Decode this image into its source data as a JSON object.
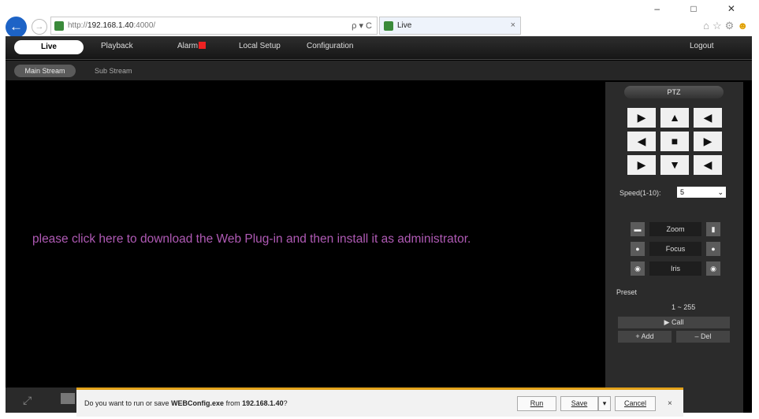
{
  "browser": {
    "url_prefix": "http://",
    "url_host": "192.168.1.40",
    "url_suffix": ":4000/",
    "address_tools": "ρ ▾ C",
    "tab_title": "Live",
    "tab_close": "×",
    "back_icon": "←",
    "forward_icon": "→",
    "window_buttons": "– □ ✕",
    "toolbar_icons": "⌂☆⚙"
  },
  "nav": {
    "items": [
      "Live",
      "Playback",
      "Alarm",
      "Local Setup",
      "Configuration"
    ],
    "logout": "Logout"
  },
  "subnav": {
    "main_stream": "Main Stream",
    "sub_stream": "Sub Stream"
  },
  "video": {
    "plugin_message": "please click here to download the Web Plug-in and then install it as administrator."
  },
  "ptz": {
    "title": "PTZ",
    "directions": [
      "▶",
      "▲",
      "◀",
      "◀",
      "■",
      "▶",
      "▶",
      "▼",
      "◀"
    ],
    "speed_label": "Speed(1-10):",
    "speed_value": "5",
    "zoom_label": "Zoom",
    "focus_label": "Focus",
    "iris_label": "Iris",
    "preset_label": "Preset",
    "preset_range": "1 ~ 255",
    "call_label": "▶  Call",
    "add_label": "+  Add",
    "del_label": "–  Del"
  },
  "download_bar": {
    "message_prefix": "Do you want to run or save ",
    "file_name": "WEBConfig.exe",
    "message_middle": " from ",
    "source": "192.168.1.40",
    "message_suffix": "?",
    "run_label": "Run",
    "save_label": "Save",
    "save_arrow": "▾",
    "cancel_label": "Cancel",
    "close_label": "×"
  },
  "colors": {
    "plugin_text": "#b05ab5",
    "back_button": "#1d63c6",
    "download_bar_accent": "#e3a21a"
  }
}
